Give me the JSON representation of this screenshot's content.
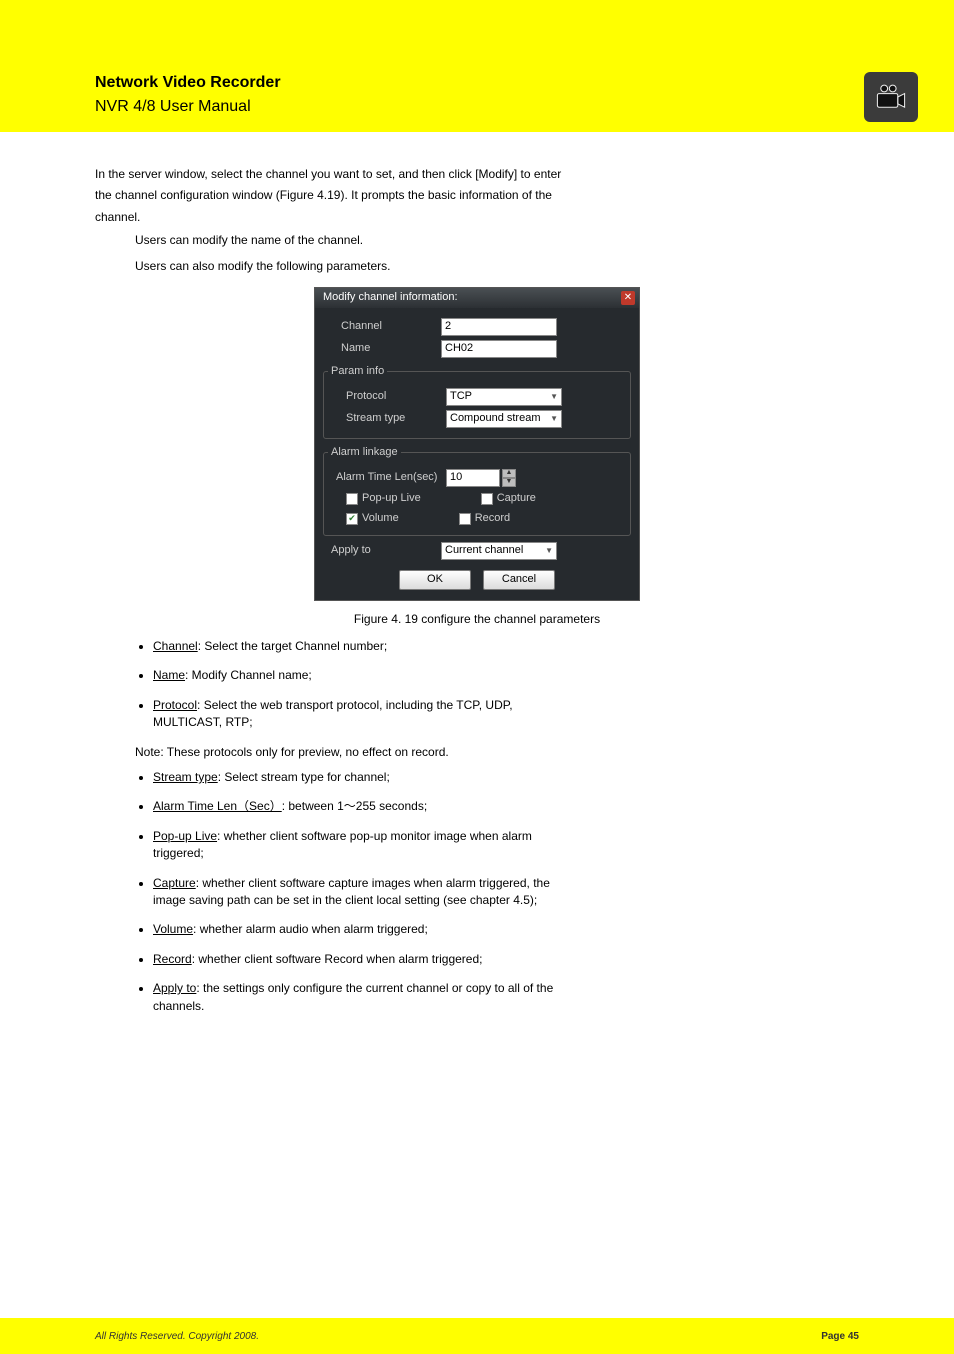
{
  "header": {
    "product_line": "Network Video Recorder",
    "model": "NVR 4/8 User Manual"
  },
  "intro": {
    "l1": "In the server window, select the channel you want to set, and then click [Modify] to enter",
    "l2": "the channel configuration window (Figure 4.19). It prompts the basic information of the",
    "l3": "channel.",
    "sub1": "Users can modify the name of the channel.",
    "sub2": "Users can also modify the following parameters."
  },
  "figure": {
    "title": "Modify channel information:",
    "channel_label": "Channel",
    "channel_value": "2",
    "name_label": "Name",
    "name_value": "CH02",
    "group_param": "Param info",
    "protocol_label": "Protocol",
    "protocol_value": "TCP",
    "stream_label": "Stream type",
    "stream_value": "Compound stream",
    "group_alarm": "Alarm linkage",
    "alarm_len_label": "Alarm Time Len(sec)",
    "alarm_len_value": "10",
    "popup": "Pop-up Live",
    "capture": "Capture",
    "volume": "Volume",
    "record": "Record",
    "apply_label": "Apply to",
    "apply_value": "Current channel",
    "ok": "OK",
    "cancel": "Cancel",
    "caption": "Figure 4. 19 configure the channel parameters"
  },
  "items": {
    "channel_name": "Channel",
    "channel_desc": ": Select the target Channel number;",
    "name_name": "Name",
    "name_desc": ": Modify Channel name;",
    "protocol_name": "Protocol",
    "protocol_desc": ": Select the web transport protocol, including the TCP, UDP,",
    "protocol_desc2": "MULTICAST, RTP;",
    "note": "Note: These protocols only for preview, no effect on record.",
    "stream_name": "Stream type",
    "stream_desc": ": Select stream type for channel;",
    "alarm_name": "Alarm Time Len（Sec）",
    "alarm_desc": ": between 1～255 seconds;",
    "popup_name": "Pop-up Live",
    "popup_desc": ": whether client software pop-up monitor image when alarm",
    "popup_desc2": "triggered;",
    "capture_name": "Capture",
    "capture_desc": ": whether client software capture images when alarm triggered, the",
    "capture_desc2": "image saving path can be set in the client local setting (see chapter 4.5);",
    "volume_name": "Volume",
    "volume_desc": ": whether alarm audio when alarm triggered;",
    "record_name": "Record",
    "record_desc": ": whether client software Record when alarm triggered;",
    "apply_name": "Apply to",
    "apply_desc": ": the settings only configure the current channel or copy to all of the",
    "apply_desc2": "channels."
  },
  "footer": {
    "left": "All Rights Reserved. Copyright 2008.",
    "right": "Page  45"
  }
}
